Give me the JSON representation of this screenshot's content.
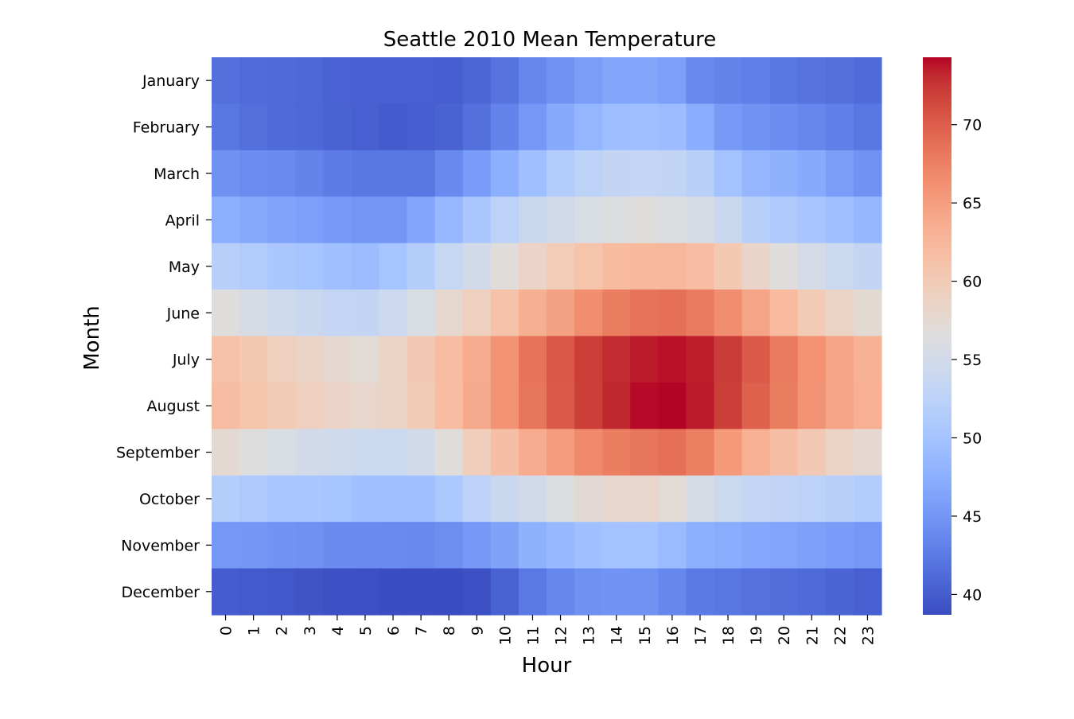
{
  "chart_data": {
    "type": "heatmap",
    "title": "Seattle 2010 Mean Temperature",
    "xlabel": "Hour",
    "ylabel": "Month",
    "colormap": "coolwarm",
    "x": [
      "0",
      "1",
      "2",
      "3",
      "4",
      "5",
      "6",
      "7",
      "8",
      "9",
      "10",
      "11",
      "12",
      "13",
      "14",
      "15",
      "16",
      "17",
      "18",
      "19",
      "20",
      "21",
      "22",
      "23"
    ],
    "y": [
      "January",
      "February",
      "March",
      "April",
      "May",
      "June",
      "July",
      "August",
      "September",
      "October",
      "November",
      "December"
    ],
    "values": [
      [
        41.6,
        41.3,
        41.1,
        40.9,
        40.4,
        40.3,
        40.3,
        40.2,
        40.1,
        40.8,
        41.9,
        43.6,
        44.6,
        45.7,
        46.6,
        46.6,
        45.9,
        43.8,
        43.3,
        42.9,
        42.2,
        41.9,
        41.6,
        41.2
      ],
      [
        42.2,
        41.5,
        41.1,
        40.9,
        40.5,
        40.2,
        39.9,
        40.1,
        40.5,
        41.6,
        43.3,
        45.2,
        47.0,
        48.3,
        49.3,
        49.4,
        49.1,
        47.3,
        45.4,
        44.6,
        44.1,
        43.5,
        42.9,
        42.2
      ],
      [
        44.5,
        44.1,
        43.9,
        43.3,
        42.6,
        42.3,
        42.3,
        42.2,
        43.8,
        45.6,
        47.5,
        49.5,
        51.2,
        52.6,
        53.3,
        53.4,
        53.2,
        52.0,
        49.8,
        48.4,
        47.8,
        47.0,
        45.7,
        44.6
      ],
      [
        47.6,
        46.9,
        46.4,
        45.9,
        45.4,
        45.0,
        45.0,
        46.6,
        48.6,
        50.6,
        52.5,
        54.1,
        55.0,
        55.8,
        56.3,
        56.6,
        56.1,
        55.5,
        54.0,
        52.0,
        51.0,
        50.3,
        49.4,
        48.5
      ],
      [
        52.0,
        51.3,
        50.6,
        50.1,
        49.5,
        49.1,
        50.1,
        51.6,
        53.6,
        55.0,
        56.8,
        58.5,
        59.8,
        61.0,
        62.1,
        62.4,
        62.5,
        61.8,
        60.3,
        58.4,
        56.6,
        55.3,
        54.2,
        53.3
      ],
      [
        56.6,
        55.6,
        54.6,
        54.0,
        53.4,
        53.3,
        54.3,
        55.8,
        57.8,
        59.3,
        61.2,
        63.4,
        64.6,
        66.4,
        67.8,
        68.5,
        68.8,
        68.0,
        66.4,
        64.4,
        62.2,
        60.0,
        58.6,
        57.4
      ],
      [
        61.2,
        60.3,
        59.4,
        58.6,
        57.6,
        57.2,
        58.7,
        60.2,
        62.0,
        63.6,
        66.0,
        68.5,
        70.5,
        72.0,
        73.0,
        73.6,
        73.9,
        73.5,
        72.2,
        70.2,
        68.0,
        66.1,
        64.4,
        63.2
      ],
      [
        61.8,
        61.0,
        60.0,
        59.3,
        58.5,
        58.1,
        58.6,
        60.0,
        61.9,
        63.8,
        66.0,
        68.3,
        70.3,
        72.0,
        73.2,
        74.1,
        74.3,
        73.6,
        72.0,
        69.8,
        67.8,
        66.0,
        64.4,
        63.3
      ],
      [
        57.5,
        56.5,
        55.8,
        55.0,
        54.6,
        54.2,
        54.2,
        55.0,
        56.8,
        59.5,
        61.7,
        63.6,
        65.2,
        66.8,
        67.8,
        68.3,
        68.8,
        67.7,
        65.5,
        63.3,
        61.6,
        60.2,
        58.6,
        57.6
      ],
      [
        51.6,
        51.0,
        50.4,
        50.4,
        50.1,
        49.6,
        49.6,
        49.6,
        50.8,
        52.6,
        54.0,
        55.0,
        56.3,
        57.3,
        58.1,
        58.1,
        57.2,
        55.5,
        54.2,
        53.4,
        53.0,
        52.6,
        52.0,
        51.4
      ],
      [
        45.2,
        45.1,
        44.8,
        44.5,
        44.0,
        44.0,
        43.9,
        43.8,
        44.3,
        45.3,
        46.3,
        47.8,
        48.7,
        49.6,
        49.9,
        49.8,
        49.0,
        47.6,
        47.2,
        46.8,
        46.5,
        46.0,
        45.6,
        45.2
      ],
      [
        40.0,
        39.8,
        39.6,
        39.3,
        39.1,
        38.9,
        38.8,
        38.8,
        38.7,
        39.0,
        40.5,
        42.4,
        43.6,
        44.5,
        44.8,
        44.6,
        43.6,
        42.5,
        42.2,
        41.7,
        41.4,
        41.1,
        40.7,
        40.2
      ]
    ],
    "vmin": 38.7,
    "vmax": 74.3,
    "colorbar": {
      "ticks": [
        40,
        45,
        50,
        55,
        60,
        65,
        70
      ],
      "tick_labels": [
        "40",
        "45",
        "50",
        "55",
        "60",
        "65",
        "70"
      ],
      "placement": "right"
    },
    "grid": false,
    "legend": "none"
  }
}
